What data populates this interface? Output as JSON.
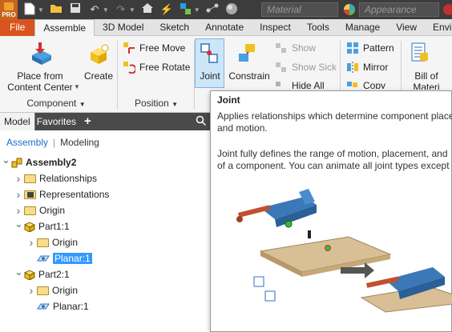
{
  "quick_access": {
    "app_badge": "PRO",
    "material_placeholder": "Material",
    "appearance_placeholder": "Appearance"
  },
  "tabs": [
    "File",
    "Assemble",
    "3D Model",
    "Sketch",
    "Annotate",
    "Inspect",
    "Tools",
    "Manage",
    "View",
    "Enviro"
  ],
  "ribbon": {
    "place_from_content_center": "Place from\nContent Center",
    "create": "Create",
    "free_move": "Free Move",
    "free_rotate": "Free Rotate",
    "joint": "Joint",
    "constrain": "Constrain",
    "show": "Show",
    "show_sick": "Show Sick",
    "hide_all": "Hide All",
    "pattern": "Pattern",
    "mirror": "Mirror",
    "copy": "Copy",
    "bill_of_materials": "Bill of\nMateri",
    "panel_component": "Component",
    "panel_position": "Position"
  },
  "browser": {
    "tab_model": "Model",
    "tab_favorites": "Favorites",
    "add": "+",
    "link_assembly": "Assembly",
    "link_modeling": "Modeling",
    "tree": [
      {
        "label": "Assembly2",
        "indent": 0,
        "type": "assembly",
        "exp": "down"
      },
      {
        "label": "Relationships",
        "indent": 1,
        "type": "folder",
        "exp": "right"
      },
      {
        "label": "Representations",
        "indent": 1,
        "type": "rep",
        "exp": "right"
      },
      {
        "label": "Origin",
        "indent": 1,
        "type": "folder",
        "exp": "right"
      },
      {
        "label": "Part1:1",
        "indent": 1,
        "type": "part",
        "exp": "down"
      },
      {
        "label": "Origin",
        "indent": 2,
        "type": "folder",
        "exp": "right"
      },
      {
        "label": "Planar:1",
        "indent": 2,
        "type": "joint",
        "exp": "",
        "selected": true
      },
      {
        "label": "Part2:1",
        "indent": 1,
        "type": "part",
        "exp": "down"
      },
      {
        "label": "Origin",
        "indent": 2,
        "type": "folder",
        "exp": "right"
      },
      {
        "label": "Planar:1",
        "indent": 2,
        "type": "joint",
        "exp": ""
      }
    ]
  },
  "tooltip": {
    "title": "Joint",
    "line1": "Applies relationships which determine component place",
    "line2": "and motion.",
    "line3": "Joint fully defines the range of motion, placement, and",
    "line4": "of a component. You can animate all joint types except"
  }
}
